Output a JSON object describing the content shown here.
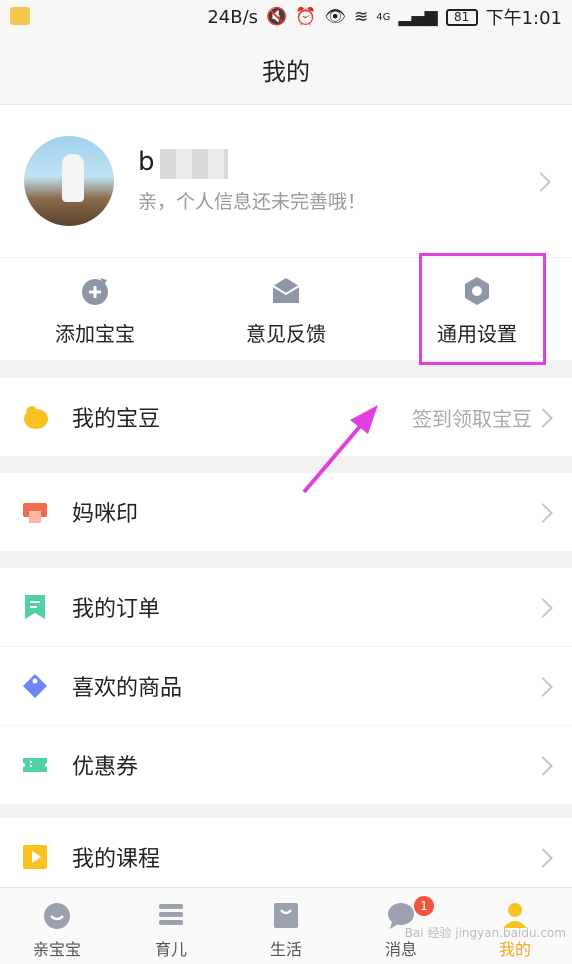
{
  "status_bar": {
    "speed": "24B/s",
    "signal_tag": "4G",
    "battery": "81",
    "time": "下午1:01"
  },
  "title": "我的",
  "profile": {
    "name": "b",
    "subtitle": "亲，个人信息还未完善哦！"
  },
  "actions": [
    {
      "label": "添加宝宝",
      "icon": "add-baby-icon"
    },
    {
      "label": "意见反馈",
      "icon": "mail-icon"
    },
    {
      "label": "通用设置",
      "icon": "gear-icon"
    }
  ],
  "menu": {
    "beans": {
      "label": "我的宝豆",
      "hint": "签到领取宝豆",
      "icon": "bean-icon"
    },
    "mommy_print": {
      "label": "妈咪印",
      "icon": "printer-icon"
    },
    "orders": {
      "label": "我的订单",
      "icon": "order-bookmark-icon"
    },
    "favorites": {
      "label": "喜欢的商品",
      "icon": "tag-icon"
    },
    "coupons": {
      "label": "优惠券",
      "icon": "ticket-icon"
    },
    "courses": {
      "label": "我的课程",
      "icon": "play-course-icon"
    }
  },
  "tabs": [
    {
      "label": "亲宝宝",
      "icon": "home-face-icon"
    },
    {
      "label": "育儿",
      "icon": "menu-lines-icon"
    },
    {
      "label": "生活",
      "icon": "shopping-bag-icon"
    },
    {
      "label": "消息",
      "icon": "chat-bubble-icon",
      "badge": "1"
    },
    {
      "label": "我的",
      "icon": "profile-icon"
    }
  ],
  "watermark": "Bai 经验 jingyan.baidu.com",
  "colors": {
    "accent": "#f5a623",
    "highlight": "#e040e0",
    "badge": "#f5533d"
  }
}
